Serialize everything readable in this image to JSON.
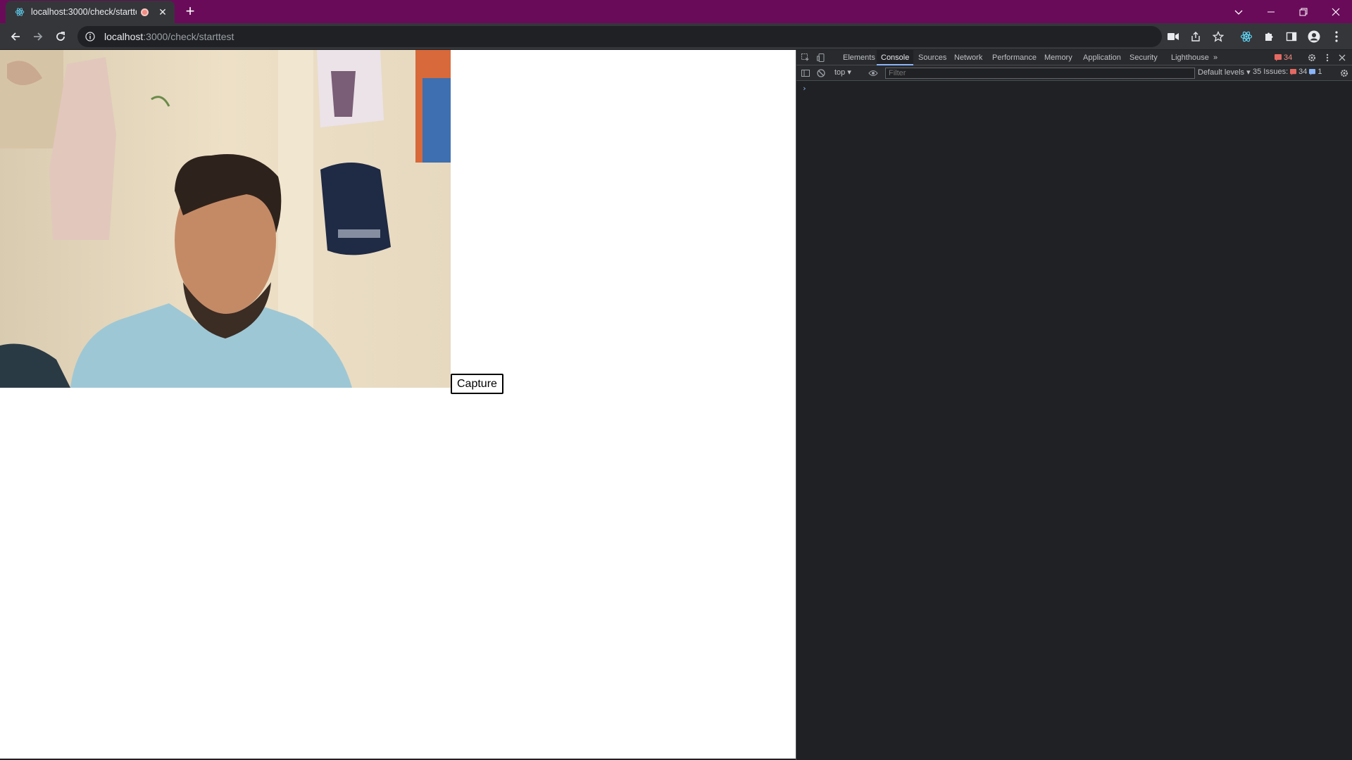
{
  "browser": {
    "tab": {
      "title": "localhost:3000/check/startte",
      "recording_indicator": "recording-dot-icon"
    },
    "new_tab_label": "+",
    "address": {
      "host": "localhost",
      "path": ":3000/check/starttest"
    },
    "window_controls": [
      "chevron-down-icon",
      "minimize-icon",
      "restore-icon",
      "close-icon"
    ],
    "toolbar_icons": [
      "camera-icon",
      "share-icon",
      "star-icon",
      "react-devtools-icon",
      "extensions-icon",
      "side-panel-icon",
      "profile-icon",
      "menu-icon"
    ]
  },
  "page": {
    "capture_label": "Capture"
  },
  "devtools": {
    "tabs": [
      "Elements",
      "Console",
      "Sources",
      "Network",
      "Performance",
      "Memory",
      "Application",
      "Security",
      "Lighthouse"
    ],
    "active_tab": "Console",
    "more_tabs": "»",
    "error_count": "34",
    "console": {
      "context": "top ▾",
      "filter_placeholder": "Filter",
      "levels": "Default levels ▾",
      "issues_label": "35 Issues:",
      "issues_errors": "34",
      "issues_info": "1",
      "prompt": "›"
    }
  },
  "colors": {
    "tabstrip": "#6a0b5a",
    "toolbar": "#35363a",
    "devtools_bg": "#202124",
    "accent": "#8ab4f8",
    "error": "#f28b82"
  }
}
